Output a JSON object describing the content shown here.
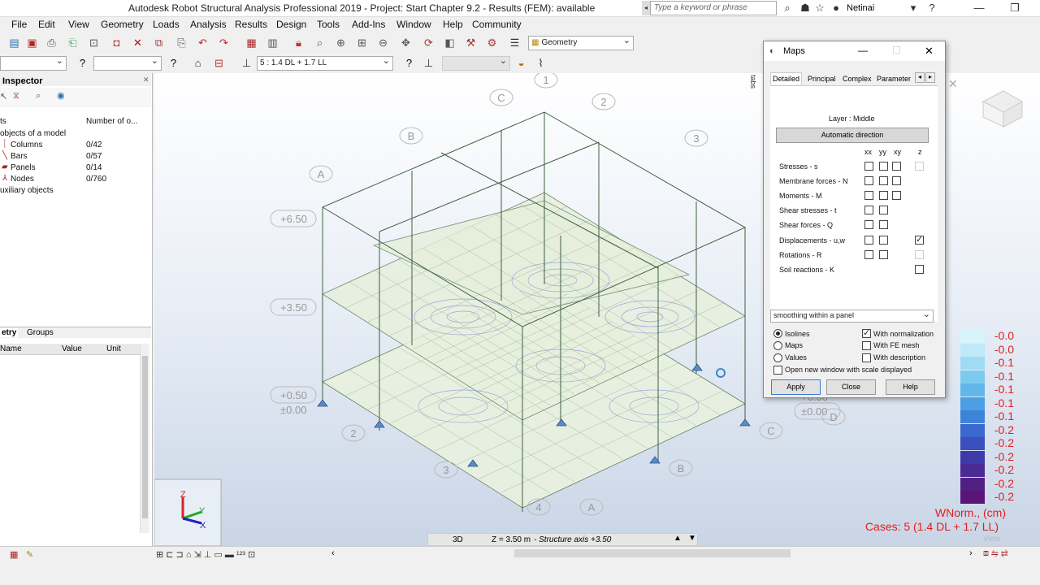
{
  "window": {
    "title": "Autodesk Robot Structural Analysis Professional 2019 - Project: Start Chapter 9.2 - Results (FEM): available",
    "search_placeholder": "Type a keyword or phrase",
    "user": "Netinai"
  },
  "menu": [
    "File",
    "Edit",
    "View",
    "Geometry",
    "Loads",
    "Analysis",
    "Results",
    "Design",
    "Tools",
    "Add-Ins",
    "Window",
    "Help",
    "Community"
  ],
  "toolbar": {
    "layout_combo": "Geometry",
    "case_combo": "5 : 1.4 DL + 1.7 LL"
  },
  "inspector": {
    "title": "Inspector",
    "col1": "ts",
    "col2": "Number of o...",
    "group": "objects of a model",
    "items": [
      {
        "name": "Columns",
        "count": "0/42"
      },
      {
        "name": "Bars",
        "count": "0/57"
      },
      {
        "name": "Panels",
        "count": "0/14"
      },
      {
        "name": "Nodes",
        "count": "0/760"
      }
    ],
    "aux": "uxiliary objects",
    "tabs": [
      "etry",
      "Groups"
    ],
    "props_cols": [
      "Name",
      "Value",
      "Unit"
    ]
  },
  "view": {
    "levels": [
      "+6.50",
      "+3.50",
      "+0.50",
      "±0.00",
      "±0.00",
      "+0.00"
    ],
    "axes": [
      "1",
      "2",
      "3",
      "A",
      "B",
      "C",
      "2",
      "3",
      "4",
      "A",
      "B",
      "C",
      "D"
    ],
    "mode": "3D",
    "zinfo": "Z = 3.50 m",
    "zaxis": "- Structure axis +3.50",
    "view_label": "View"
  },
  "maps": {
    "title": "Maps",
    "tabs": [
      "Detailed",
      "Principal",
      "Complex",
      "Parameter"
    ],
    "layer": "Layer : Middle",
    "auto_btn": "Automatic direction",
    "cols": [
      "xx",
      "yy",
      "xy",
      "z"
    ],
    "rows": [
      {
        "label": "Stresses - s",
        "xx": false,
        "yy": false,
        "xy": false,
        "z": "dis"
      },
      {
        "label": "Membrane forces - N",
        "xx": false,
        "yy": false,
        "xy": false
      },
      {
        "label": "Moments - M",
        "xx": false,
        "yy": false,
        "xy": false
      },
      {
        "label": "Shear stresses - t",
        "xx": false,
        "yy": false
      },
      {
        "label": "Shear forces - Q",
        "xx": false,
        "yy": false
      },
      {
        "label": "Displacements - u,w",
        "xx": false,
        "yy": false,
        "z": "checked"
      },
      {
        "label": "Rotations - R",
        "xx": false,
        "yy": false,
        "z": "dis"
      },
      {
        "label": "Soil reactions - K",
        "z": "empty"
      }
    ],
    "smoothing": "smoothing within a panel",
    "radios": [
      "Isolines",
      "Maps",
      "Values"
    ],
    "selected_radio": "Isolines",
    "checks": [
      {
        "label": "With normalization",
        "checked": true
      },
      {
        "label": "With FE mesh",
        "checked": false
      },
      {
        "label": "With description",
        "checked": false
      }
    ],
    "open_new": "Open new window with scale displayed",
    "buttons": [
      "Apply",
      "Close",
      "Help"
    ]
  },
  "legend": {
    "values": [
      "-0.0",
      "-0.0",
      "-0.1",
      "-0.1",
      "-0.1",
      "-0.1",
      "-0.1",
      "-0.2",
      "-0.2",
      "-0.2",
      "-0.2",
      "-0.2",
      "-0.2"
    ],
    "colors": [
      "#d8f4fb",
      "#bfe9f7",
      "#9fdcf3",
      "#7ccbef",
      "#62b7ea",
      "#4b9fe2",
      "#3d84d9",
      "#3a68cc",
      "#3b4fbd",
      "#3f3aa9",
      "#4a2b95",
      "#521f83",
      "#5a1676"
    ],
    "unit": "WNorm., (cm)",
    "cases": "Cases: 5 (1.4 DL + 1.7 LL)"
  }
}
